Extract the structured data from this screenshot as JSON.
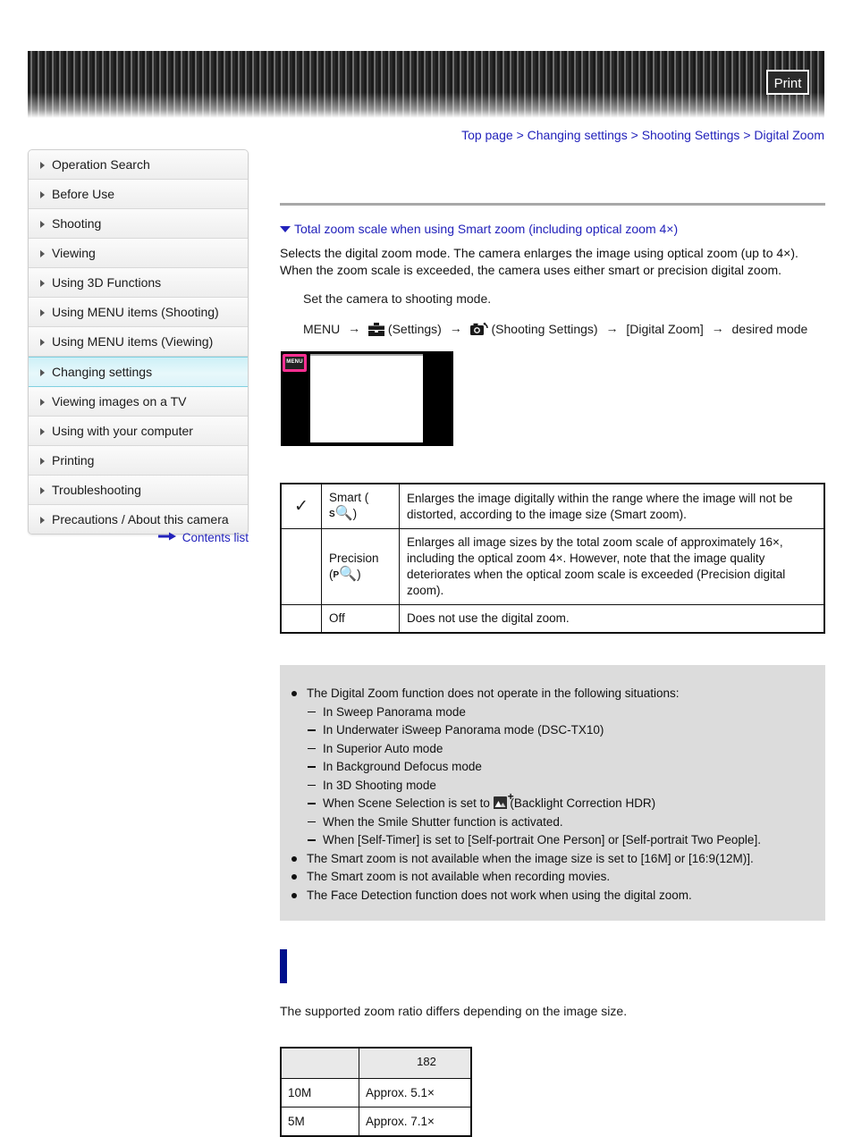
{
  "header": {
    "print_label": "Print"
  },
  "breadcrumb": {
    "separator": ">",
    "items": [
      {
        "label": "Top page"
      },
      {
        "label": "Changing settings"
      },
      {
        "label": "Shooting Settings"
      },
      {
        "label": "Digital Zoom"
      }
    ]
  },
  "sidebar": {
    "items": [
      {
        "label": "Operation Search",
        "active": false
      },
      {
        "label": "Before Use",
        "active": false
      },
      {
        "label": "Shooting",
        "active": false
      },
      {
        "label": "Viewing",
        "active": false
      },
      {
        "label": "Using 3D Functions",
        "active": false
      },
      {
        "label": "Using MENU items (Shooting)",
        "active": false
      },
      {
        "label": "Using MENU items (Viewing)",
        "active": false
      },
      {
        "label": "Changing settings",
        "active": true
      },
      {
        "label": "Viewing images on a TV",
        "active": false
      },
      {
        "label": "Using with your computer",
        "active": false
      },
      {
        "label": "Printing",
        "active": false
      },
      {
        "label": "Troubleshooting",
        "active": false
      },
      {
        "label": "Precautions / About this camera",
        "active": false
      }
    ],
    "contents_link": "Contents list"
  },
  "main": {
    "section_heading": "Total zoom scale when using Smart zoom (including optical zoom 4×)",
    "intro_line_1": "Selects the digital zoom mode. The camera enlarges the image using optical zoom (up to 4×).",
    "intro_line_2": "When the zoom scale is exceeded, the camera uses either smart or precision digital zoom.",
    "step_1": "Set the camera to shooting mode.",
    "menu_path": {
      "start": "MENU",
      "arrow": "→",
      "settings_label": "(Settings)",
      "shooting_settings_label": "(Shooting Settings)",
      "item_label": "[Digital Zoom]",
      "end_label": "desired mode"
    },
    "lcd_figure": {
      "menu_button_label": "MENU"
    },
    "mode_table": {
      "rows": [
        {
          "checked": "✓",
          "name": "Smart (",
          "icon_sup": "S",
          "icon_glass": "🔍",
          "name_close": ")",
          "description": "Enlarges the image digitally within the range where the image will not be distorted, according to the image size (Smart zoom)."
        },
        {
          "checked": "",
          "name": "Precision",
          "icon_sup": "P",
          "icon_glass": "🔍",
          "name_open": "(",
          "name_close": ")",
          "description": "Enlarges all image sizes by the total zoom scale of approximately 16×, including the optical zoom 4×. However, note that the image quality deteriorates when the optical zoom scale is exceeded (Precision digital zoom)."
        },
        {
          "checked": "",
          "name": "Off",
          "description": "Does not use the digital zoom."
        }
      ]
    },
    "notes": [
      {
        "type": "bullet",
        "text": "The Digital Zoom function does not operate in the following situations:"
      },
      {
        "type": "dash",
        "text": "In Sweep Panorama mode"
      },
      {
        "type": "dash",
        "text": "In Underwater iSweep Panorama mode (DSC-TX10)"
      },
      {
        "type": "dash",
        "text": "In Superior Auto mode"
      },
      {
        "type": "dash",
        "text": "In Background Defocus mode"
      },
      {
        "type": "dash",
        "text": "In 3D Shooting mode"
      },
      {
        "type": "dash-icon",
        "text_before": "When Scene Selection is set to",
        "text_after": "(Backlight Correction HDR)"
      },
      {
        "type": "dash",
        "text": "When the Smile Shutter function is activated."
      },
      {
        "type": "dash",
        "text": "When [Self-Timer] is set to [Self-portrait One Person] or [Self-portrait Two People]."
      },
      {
        "type": "bullet",
        "text": "The Smart zoom is not available when the image size is set to [16M] or [16:9(12M)]."
      },
      {
        "type": "bullet",
        "text": "The Smart zoom is not available when recording movies."
      },
      {
        "type": "bullet",
        "text": "The Face Detection function does not work when using the digital zoom."
      }
    ],
    "trailing_para": "The supported zoom ratio differs depending on the image size.",
    "ratio_table": {
      "header": {
        "col_a": "",
        "col_b": ""
      },
      "rows": [
        {
          "col_a": "10M",
          "col_b": "Approx. 5.1×"
        },
        {
          "col_a": "5M",
          "col_b": "Approx. 7.1×"
        }
      ]
    }
  },
  "footer": {
    "page_number": "182"
  }
}
